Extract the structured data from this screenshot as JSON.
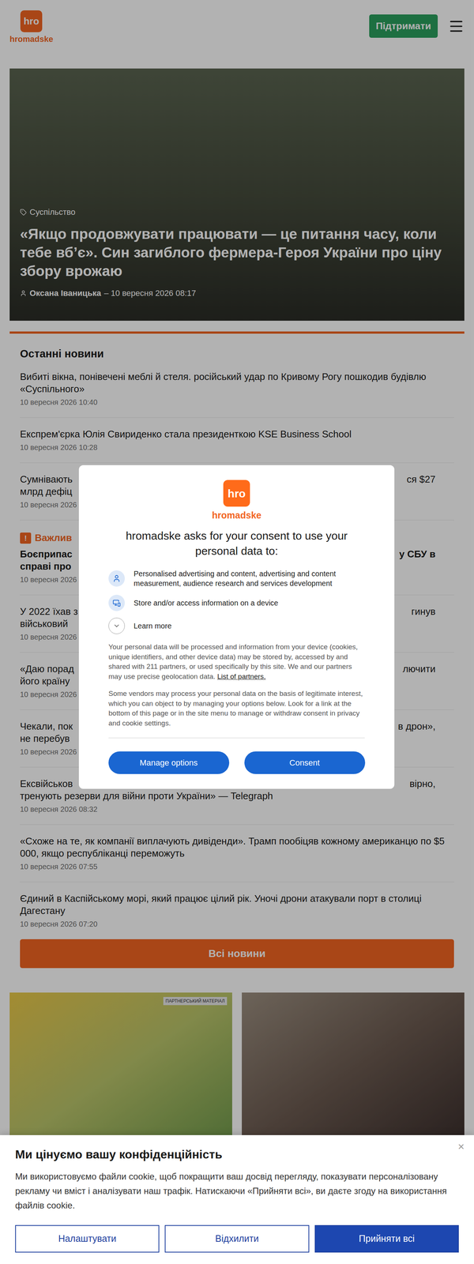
{
  "header": {
    "logo": "hro",
    "brand": "hromadske",
    "support_button": "Підтримати"
  },
  "hero": {
    "category": "Суспільство",
    "title": "«Якщо продовжувати працювати — це питання часу, коли тебе вб’є». Син загиблого фермера-Героя України про ціну збору врожаю",
    "author": "Оксана Іваницька",
    "date": "– 10 вересня 2026 08:17"
  },
  "latest": {
    "title": "Останні новини",
    "items": [
      {
        "kind": "full",
        "important": false,
        "title": "Вибиті вікна, понівечені меблі й стеля. російський удар по Кривому Рогу пошкодив будівлю «Суспільного»",
        "date": "10 вересня 2026 10:40"
      },
      {
        "kind": "full",
        "important": false,
        "title": "Експрем'єрка Юлія Свириденко стала президенткою KSE Business School",
        "date": "10 вересня 2026 10:28"
      },
      {
        "kind": "covered",
        "important": false,
        "lines": [
          {
            "left": "Сумнівають",
            "right": "ся $27"
          },
          {
            "left": "млрд дефіц",
            "right": ""
          }
        ],
        "date": "10 вересня 2026"
      },
      {
        "kind": "covered",
        "important": true,
        "label_icon": "!",
        "label": "Важлив",
        "lines": [
          {
            "left": "Боєприпас",
            "right": "у СБУ в"
          },
          {
            "left": "справі про",
            "right": ""
          }
        ],
        "date": "10 вересня 2026"
      },
      {
        "kind": "covered",
        "important": false,
        "lines": [
          {
            "left": "У 2022 їхав з",
            "right": "гинув"
          },
          {
            "left": "військовий",
            "right": ""
          }
        ],
        "date": "10 вересня 2026"
      },
      {
        "kind": "covered",
        "important": false,
        "lines": [
          {
            "left": "«Даю порад",
            "right": "лючити"
          },
          {
            "left": "його країну",
            "right": ""
          }
        ],
        "date": "10 вересня 2026"
      },
      {
        "kind": "covered",
        "important": false,
        "lines": [
          {
            "left": "Чекали, пок",
            "right": "в дрон»,"
          },
          {
            "left": "не перебув",
            "right": ""
          }
        ],
        "date": "10 вересня 2026"
      },
      {
        "kind": "covered",
        "important": false,
        "lines": [
          {
            "left": "Ексвійськов",
            "right": "вірно,"
          },
          {
            "left": "тренують резерви для війни проти України» — Telegraph",
            "right": ""
          }
        ],
        "date": "10 вересня 2026 08:32"
      },
      {
        "kind": "full",
        "important": false,
        "title": "«Схоже на те, як компанії виплачують дивіденди». Трамп пообіцяв кожному американцю по $5 000, якщо республіканці переможуть",
        "date": "10 вересня 2026 07:55"
      },
      {
        "kind": "full",
        "important": false,
        "title": "Єдиний в Каспійському морі, який працює цілий рік. Уночі дрони атакували порт в столиці Дагестану",
        "date": "10 вересня 2026 07:20"
      }
    ],
    "all_button": "Всі новини"
  },
  "cards": [
    {
      "kind": "partner",
      "badge": "ПАРТНЕРСЬКИЙ МАТЕРІАЛ"
    },
    {
      "kind": "photo",
      "badge": ""
    }
  ],
  "consent_modal": {
    "logo": "hro",
    "brand": "hromadske",
    "heading": "hromadske asks for your consent to use your personal data to:",
    "purposes": [
      {
        "kind": "person",
        "text": "Personalised advertising and content, advertising and content measurement, audience research and services development"
      },
      {
        "kind": "device",
        "text": "Store and/or access information on a device"
      }
    ],
    "learn_more": "Learn more",
    "paragraph1": "Your personal data will be processed and information from your device (cookies, unique identifiers, and other device data) may be stored by, accessed by and shared with 211 partners, or used specifically by this site. We and our partners may use precise geolocation data.",
    "partners_link": "List of partners.",
    "paragraph2": "Some vendors may process your personal data on the basis of legitimate interest, which you can object to by managing your options below. Look for a link at the bottom of this page or in the site menu to manage or withdraw consent in privacy and cookie settings.",
    "buttons": [
      "Manage options",
      "Consent"
    ]
  },
  "cookie_banner": {
    "title": "Ми цінуємо вашу конфіденційність",
    "close": "×",
    "text": "Ми використовуємо файли cookie, щоб покращити ваш досвід перегляду, показувати персоналізовану рекламу чи вміст і аналізувати наш трафік. Натискаючи «Прийняти всі», ви даєте згоду на використання файлів cookie.",
    "buttons": [
      {
        "label": "Налаштувати",
        "primary": false
      },
      {
        "label": "Відхилити",
        "primary": false
      },
      {
        "label": "Прийняти всі",
        "primary": true
      }
    ]
  }
}
